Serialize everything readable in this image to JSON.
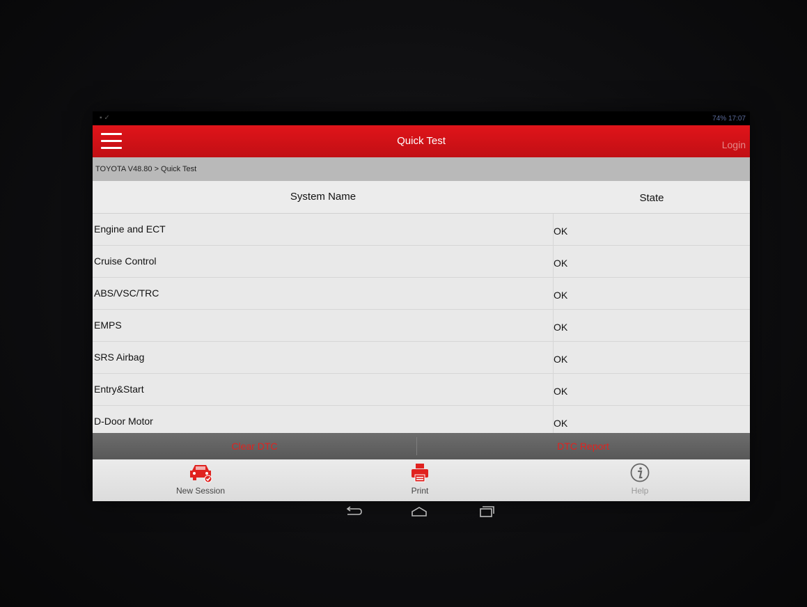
{
  "app": {
    "title": "Quick Test",
    "login_label": "Login",
    "breadcrumb": "TOYOTA V48.80 > Quick Test",
    "accent_color": "#d41218"
  },
  "status_bar": {
    "indicators": "74%  17:07"
  },
  "table": {
    "headers": {
      "system": "System Name",
      "state": "State"
    },
    "rows": [
      {
        "system": "Engine and ECT",
        "state": "OK"
      },
      {
        "system": "Cruise Control",
        "state": "OK"
      },
      {
        "system": "ABS/VSC/TRC",
        "state": "OK"
      },
      {
        "system": "EMPS",
        "state": "OK"
      },
      {
        "system": "SRS Airbag",
        "state": "OK"
      },
      {
        "system": "Entry&Start",
        "state": "OK"
      },
      {
        "system": "D-Door Motor",
        "state": "OK"
      }
    ]
  },
  "actions": {
    "clear_dtc": "Clear DTC",
    "dtc_report": "DTC Report"
  },
  "tabs": {
    "new_session": {
      "label": "New Session",
      "icon": "car-check-icon"
    },
    "print": {
      "label": "Print",
      "icon": "printer-icon"
    },
    "help": {
      "label": "Help",
      "icon": "info-icon"
    }
  },
  "system_nav": {
    "back": "back-icon",
    "home": "home-icon",
    "recents": "recents-icon"
  }
}
